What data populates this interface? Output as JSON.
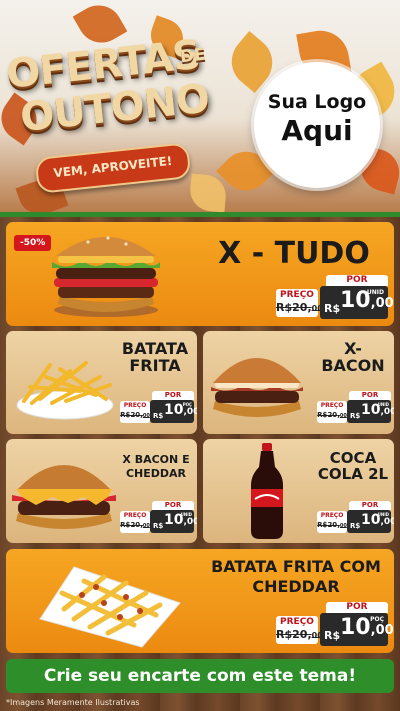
{
  "header": {
    "title_line1": "OFERTAS",
    "title_line2": "OUTONO",
    "title_de": "DE",
    "subtitle": "VEM, APROVEITE!",
    "logo_line1": "Sua Logo",
    "logo_line2": "Aqui"
  },
  "products": [
    {
      "name": "X - TUDO",
      "discount": "-50%",
      "preco_label": "PREÇO",
      "old_price": "20",
      "old_cents": "00",
      "por": "POR",
      "currency": "R$",
      "price": "10",
      "cents": "00",
      "unit": "UNID"
    },
    {
      "name": "BATATA FRITA",
      "preco_label": "PREÇO",
      "old_price": "20",
      "old_cents": "00",
      "por": "POR",
      "currency": "R$",
      "price": "10",
      "cents": "00",
      "unit": "POÇ"
    },
    {
      "name": "X- BACON",
      "preco_label": "PREÇO",
      "old_price": "20",
      "old_cents": "00",
      "por": "POR",
      "currency": "R$",
      "price": "10",
      "cents": "00",
      "unit": "UNID"
    },
    {
      "name": "X BACON E CHEDDAR",
      "preco_label": "PREÇO",
      "old_price": "20",
      "old_cents": "00",
      "por": "POR",
      "currency": "R$",
      "price": "10",
      "cents": "00",
      "unit": "UNID"
    },
    {
      "name": "COCA COLA 2L",
      "preco_label": "PREÇO",
      "old_price": "20",
      "old_cents": "00",
      "por": "POR",
      "currency": "R$",
      "price": "10",
      "cents": "00",
      "unit": "UNID"
    },
    {
      "name": "BATATA FRITA COM CHEDDAR",
      "preco_label": "PREÇO",
      "old_price": "20",
      "old_cents": "00",
      "por": "POR",
      "currency": "R$",
      "price": "10",
      "cents": "00",
      "unit": "POÇ"
    }
  ],
  "footer": {
    "cta": "Crie seu encarte com este tema!",
    "disclaimer": "*Imagens Meramente Ilustrativas"
  },
  "colors": {
    "orange": "#F39A18",
    "red": "#D3171C",
    "green": "#2E8F2A",
    "wood": "#6B4428"
  }
}
